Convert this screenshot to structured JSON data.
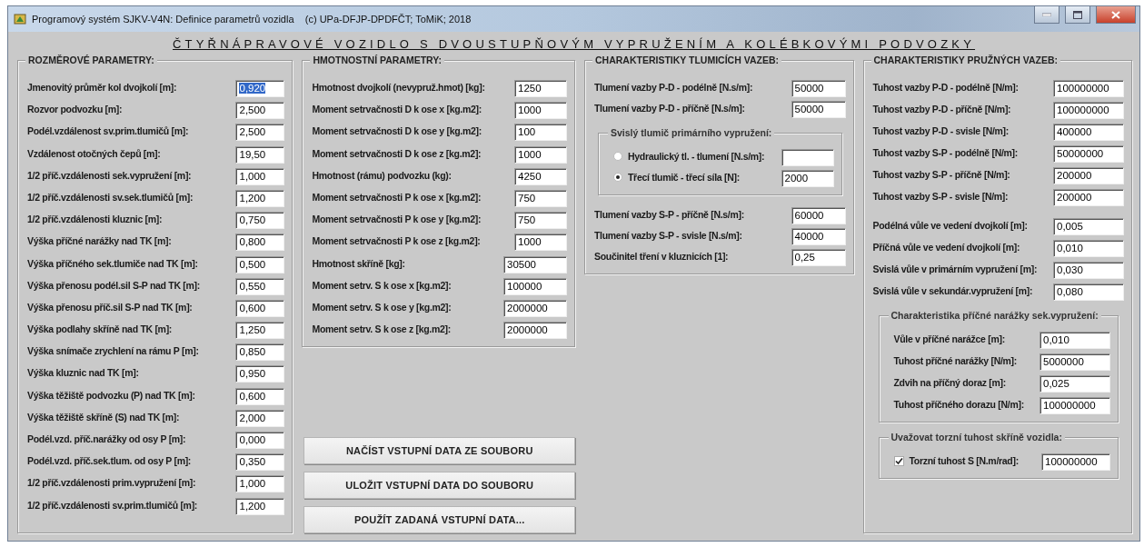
{
  "window": {
    "title": "Programový systém SJKV-V4N: Definice parametrů vozidla    (c) UPa-DFJP-DPDFČT; ToMiK; 2018"
  },
  "heading": "ČTYŘNÁPRAVOVÉ VOZIDLO S DVOUSTUPŇOVÝM VYPRUŽENÍM A KOLÉBKOVÝMI PODVOZKY",
  "panels": [
    {
      "title": "ROZMĚROVÉ PARAMETRY:",
      "blocks": [
        {
          "kind": "fields",
          "fields": [
            {
              "label": "Jmenovitý průměr kol dvojkolí [m]:",
              "value": "0,920",
              "focused": true
            },
            {
              "label": "Rozvor podvozku [m]:",
              "value": "2,500",
              "focused": false
            },
            {
              "label": "Podél.vzdálenost sv.prim.tlumičů [m]:",
              "value": "2,500",
              "focused": false
            },
            {
              "label": "Vzdálenost otočných čepů [m]:",
              "value": "19,50",
              "focused": false
            },
            {
              "label": "1/2 příč.vzdálenosti sek.vypružení [m]:",
              "value": "1,000",
              "focused": false
            },
            {
              "label": "1/2 příč.vzdálenosti sv.sek.tlumičů [m]:",
              "value": "1,200",
              "focused": false
            },
            {
              "label": "1/2 příč.vzdálenosti kluznic [m]:",
              "value": "0,750",
              "focused": false
            },
            {
              "label": "Výška příčné narážky nad TK [m]:",
              "value": "0,800",
              "focused": false
            },
            {
              "label": "Výška příčného sek.tlumiče nad TK [m]:",
              "value": "0,500",
              "focused": false
            },
            {
              "label": "Výška přenosu podél.sil S-P nad TK [m]:",
              "value": "0,550",
              "focused": false
            },
            {
              "label": "Výška přenosu příč.sil S-P nad TK [m]:",
              "value": "0,600",
              "focused": false
            },
            {
              "label": "Výška podlahy skříně nad TK [m]:",
              "value": "1,250",
              "focused": false
            },
            {
              "label": "Výška snímače zrychlení na rámu P [m]:",
              "value": "0,850",
              "focused": false
            },
            {
              "label": "Výška kluznic nad TK [m]:",
              "value": "0,950",
              "focused": false
            },
            {
              "label": "Výška těžiště podvozku (P) nad TK [m]:",
              "value": "0,600",
              "focused": false
            },
            {
              "label": "Výška těžiště skříně (S) nad TK [m]:",
              "value": "2,000",
              "focused": false
            },
            {
              "label": "Podél.vzd. příč.narážky od osy P [m]:",
              "value": "0,000",
              "focused": false
            },
            {
              "label": "Podél.vzd. příč.sek.tlum. od osy P [m]:",
              "value": "0,350",
              "focused": false
            },
            {
              "label": "1/2 příč.vzdálenosti prim.vypružení [m]:",
              "value": "1,000",
              "focused": false
            },
            {
              "label": "1/2 příč.vzdálenosti sv.prim.tlumičů [m]:",
              "value": "1,200",
              "focused": false
            }
          ]
        }
      ]
    },
    {
      "title": "HMOTNOSTNÍ PARAMETRY:",
      "blocks": [
        {
          "kind": "fields",
          "fields": [
            {
              "label": "Hmotnost dvojkolí (nevypruž.hmot) [kg]:",
              "value": "1250",
              "focused": false
            },
            {
              "label": "Moment setrvačnosti D k ose x [kg.m2]:",
              "value": "1000",
              "focused": false
            },
            {
              "label": "Moment setrvačnosti D k ose y [kg.m2]:",
              "value": "100",
              "focused": false
            },
            {
              "label": "Moment setrvačnosti D k ose z [kg.m2]:",
              "value": "1000",
              "focused": false
            },
            {
              "label": "Hmotnost (rámu) podvozku (kg):",
              "value": "4250",
              "focused": false
            },
            {
              "label": "Moment setrvačnosti P k ose x [kg.m2]:",
              "value": "750",
              "focused": false
            },
            {
              "label": "Moment setrvačnosti P k ose y [kg.m2]:",
              "value": "750",
              "focused": false
            },
            {
              "label": "Moment setrvačnosti P k ose z [kg.m2]:",
              "value": "1000",
              "focused": false
            },
            {
              "label": "Hmotnost skříně [kg]:",
              "value": "30500",
              "focused": false
            },
            {
              "label": "Moment setrv. S k ose x [kg.m2]:",
              "value": "100000",
              "focused": false
            },
            {
              "label": "Moment setrv. S k ose y [kg.m2]:",
              "value": "2000000",
              "focused": false
            },
            {
              "label": "Moment setrv. S k ose z [kg.m2]:",
              "value": "2000000",
              "focused": false
            }
          ]
        }
      ]
    },
    {
      "title": "CHARAKTERISTIKY TLUMICÍCH VAZEB:",
      "blocks": [
        {
          "kind": "fields",
          "fields": [
            {
              "label": "Tlumení vazby P-D - podélně [N.s/m]:",
              "value": "50000",
              "focused": false
            },
            {
              "label": "Tlumení vazby P-D - příčně [N.s/m]:",
              "value": "50000",
              "focused": false
            }
          ]
        },
        {
          "kind": "radio_group",
          "title": "Svislý tlumič primárního vypružení:",
          "options": [
            {
              "label": "Hydraulický tl. - tlumení [N.s/m]:",
              "selected": false
            },
            {
              "label": "Třecí tlumič - třecí síla [N]:",
              "value": "2000",
              "selected": true
            }
          ]
        },
        {
          "kind": "fields",
          "fields": [
            {
              "label": "Tlumení vazby S-P - příčně [N.s/m]:",
              "value": "60000",
              "focused": false
            },
            {
              "label": "Tlumení vazby S-P - svisle [N.s/m]:",
              "value": "40000",
              "focused": false
            },
            {
              "label": "Součinitel tření v kluznicích [1]:",
              "value": "0,25",
              "focused": false
            }
          ]
        }
      ]
    },
    {
      "title": "CHARAKTERISTIKY PRUŽNÝCH VAZEB:",
      "blocks": [
        {
          "kind": "fields",
          "fields": [
            {
              "label": "Tuhost vazby P-D - podélně [N/m]:",
              "value": "100000000",
              "focused": false
            },
            {
              "label": "Tuhost vazby P-D - příčně [N/m]:",
              "value": "100000000",
              "focused": false
            },
            {
              "label": "Tuhost vazby P-D - svisle [N/m]:",
              "value": "400000",
              "focused": false
            },
            {
              "label": "Tuhost vazby S-P - podélně [N/m]:",
              "value": "50000000",
              "focused": false
            },
            {
              "label": "Tuhost vazby S-P - příčně [N/m]:",
              "value": "200000",
              "focused": false
            },
            {
              "label": "Tuhost vazby S-P - svisle [N/m]:",
              "value": "200000",
              "focused": false
            }
          ]
        },
        {
          "kind": "fields",
          "fields": [
            {
              "label": "Podélná vůle ve vedení dvojkolí [m]:",
              "value": "0,005",
              "focused": false
            },
            {
              "label": "Příčná vůle ve vedení dvojkolí [m]:",
              "value": "0,010",
              "focused": false
            },
            {
              "label": "Svislá vůle v primárním vypružení [m]:",
              "value": "0,030",
              "focused": false
            },
            {
              "label": "Svislá vůle v sekundár.vypružení [m]:",
              "value": "0,080",
              "focused": false
            }
          ]
        },
        {
          "kind": "subgroup",
          "title": "Charakteristika příčné narážky sek.vypružení:",
          "fields": [
            {
              "label": "Vůle v příčné narážce [m]:",
              "value": "0,010",
              "focused": false
            },
            {
              "label": "Tuhost příčné narážky [N/m]:",
              "value": "5000000",
              "focused": false
            },
            {
              "label": "Zdvih na příčný doraz [m]:",
              "value": "0,025",
              "focused": false
            },
            {
              "label": "Tuhost příčného dorazu [N/m]:",
              "value": "100000000",
              "focused": false
            }
          ]
        },
        {
          "kind": "checkbox_group",
          "title": "Uvažovat torzní tuhost skříně vozidla:",
          "checkbox": {
            "label": "Torzní tuhost S [N.m/rad]:",
            "value": "100000000",
            "checked": true
          }
        }
      ]
    }
  ],
  "buttons": [
    "NAČÍST VSTUPNÍ DATA ZE SOUBORU",
    "ULOŽIT VSTUPNÍ DATA DO SOUBORU",
    "POUŽÍT ZADANÁ VSTUPNÍ DATA..."
  ]
}
